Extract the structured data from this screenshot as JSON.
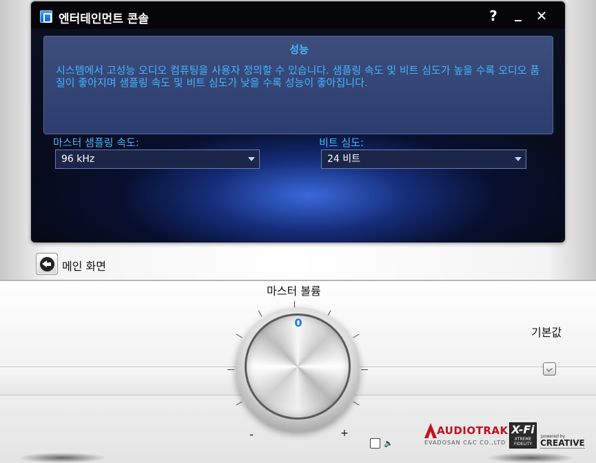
{
  "window": {
    "title": "엔터테인먼트 콘솔",
    "help_label": "?",
    "minimize_label": "_",
    "close_label": "✕"
  },
  "performance": {
    "heading": "성능",
    "description": "시스템에서 고성능 오디오 컴퓨팅을 사용자 정의할 수 있습니다. 샘플링 속도 및 비트 심도가 높을 수록 오디오 품질이 좋아지며 샘플링 속도 및 비트 심도가 낮을 수록 성능이 좋아집니다.",
    "sample_rate_label": "마스터 샘플링 속도:",
    "sample_rate_value": "96 kHz",
    "bit_depth_label": "비트 심도:",
    "bit_depth_value": "24 비트"
  },
  "nav": {
    "back_label": "메인 화면"
  },
  "volume": {
    "label": "마스터 볼륨",
    "value": "0",
    "min_label": "-",
    "max_label": "+",
    "default_label": "기본값",
    "mute_icon": "speaker-icon"
  },
  "branding": {
    "audiotrak": "AUDIOTRAK",
    "audiotrak_sub": "EVADOSAN C&C CO.,LTD",
    "xfi": "X-Fi",
    "xfi_sub": "XTREME FIDELITY",
    "powered": "powered by",
    "creative": "CREATIVE"
  },
  "colors": {
    "accent": "#4ab8ff",
    "dial_value": "#1b79e8"
  }
}
